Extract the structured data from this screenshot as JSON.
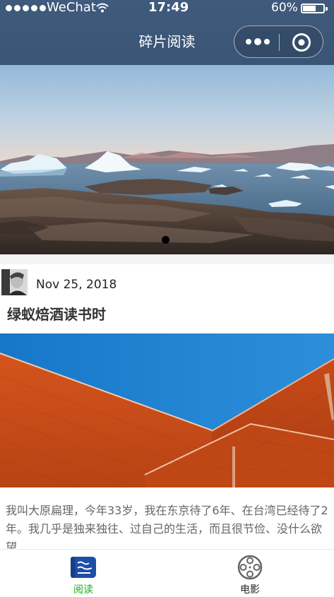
{
  "status_bar": {
    "carrier": "WeChat",
    "time": "17:49",
    "battery": "60%",
    "battery_level": 0.6
  },
  "nav": {
    "title": "碎片阅读"
  },
  "swiper": {
    "slide_count": 1,
    "current_index": 0
  },
  "post": {
    "date": "Nov 25, 2018",
    "title": "绿蚁焙酒读书时",
    "excerpt": "我叫大原扁理，今年33岁，我在东京待了6年、在台湾已经待了2年。我几乎是独来独往、过自己的生活，而且很节俭、没什么欲望"
  },
  "tabbar": {
    "items": [
      {
        "label": "阅读",
        "icon": "book-icon",
        "active": true
      },
      {
        "label": "电影",
        "icon": "film-reel-icon",
        "active": false
      }
    ],
    "active_color": "#1aad19"
  },
  "colors": {
    "nav_background": "#3f5a7c",
    "tab_active": "#1aad19"
  }
}
